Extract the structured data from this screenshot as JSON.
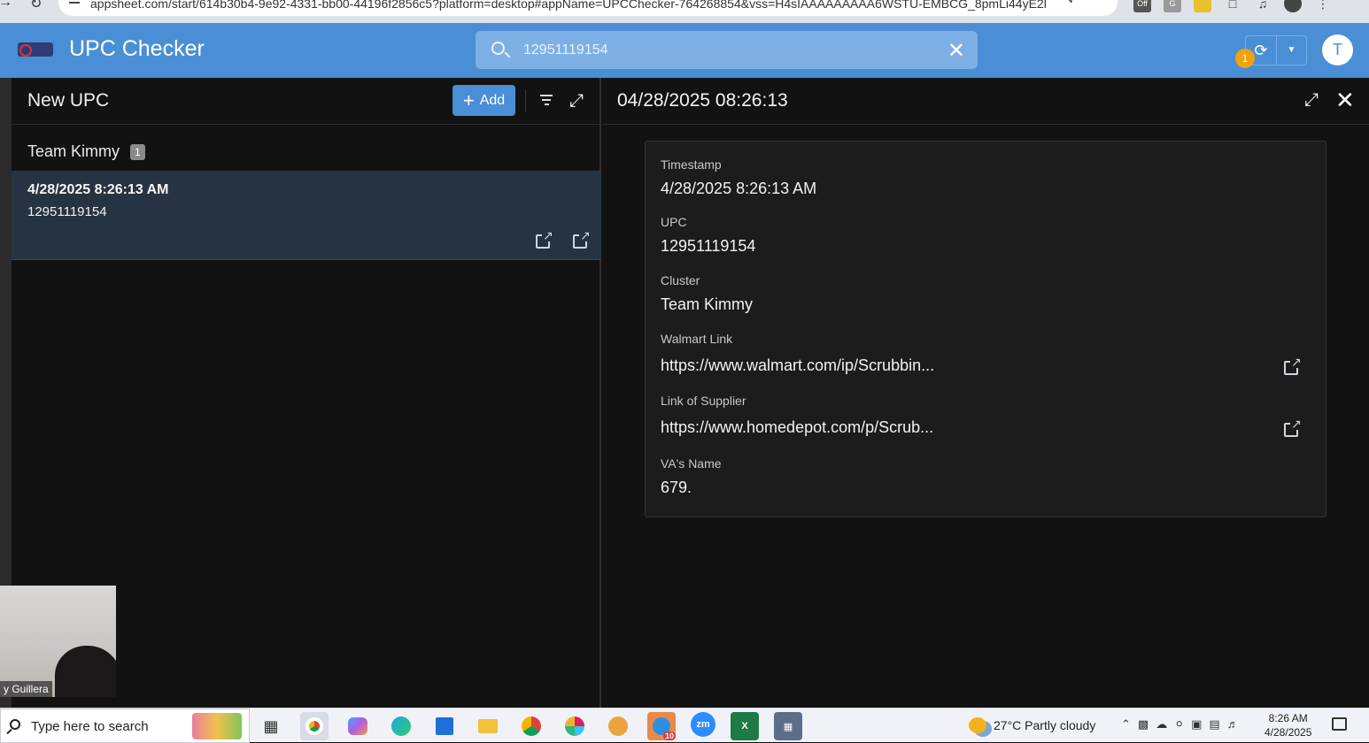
{
  "browser": {
    "url": "appsheet.com/start/614b30b4-9e92-4331-bb00-44196f2856c5?platform=desktop#appName=UPCChecker-764268854&vss=H4sIAAAAAAAAA6WSTU-EMBCG_8pmLi44yE2l4...",
    "ext_badge": "Off"
  },
  "app": {
    "title": "UPC Checker",
    "search_value": "12951119154",
    "sync_badge": "1",
    "avatar_initial": "T"
  },
  "left_panel": {
    "title": "New UPC",
    "add_label": "Add",
    "group": {
      "name": "Team Kimmy",
      "count": "1"
    },
    "items": [
      {
        "timestamp": "4/28/2025 8:26:13 AM",
        "upc": "12951119154"
      }
    ]
  },
  "detail": {
    "title": "04/28/2025 08:26:13",
    "fields": [
      {
        "label": "Timestamp",
        "value": "4/28/2025 8:26:13 AM"
      },
      {
        "label": "UPC",
        "value": "12951119154"
      },
      {
        "label": "Cluster",
        "value": "Team Kimmy"
      },
      {
        "label": "Walmart Link",
        "value": "https://www.walmart.com/ip/Scrubbin..."
      },
      {
        "label": "Link of Supplier",
        "value": "https://www.homedepot.com/p/Scrub..."
      },
      {
        "label": "VA's Name",
        "value": "679."
      }
    ]
  },
  "webcam": {
    "name": "y Guillera"
  },
  "taskbar": {
    "search_placeholder": "Type here to search",
    "weather": "27°C  Partly cloudy",
    "time": "8:26 AM",
    "date": "4/28/2025",
    "mail_badge": "10",
    "zoom_label": "zm"
  }
}
